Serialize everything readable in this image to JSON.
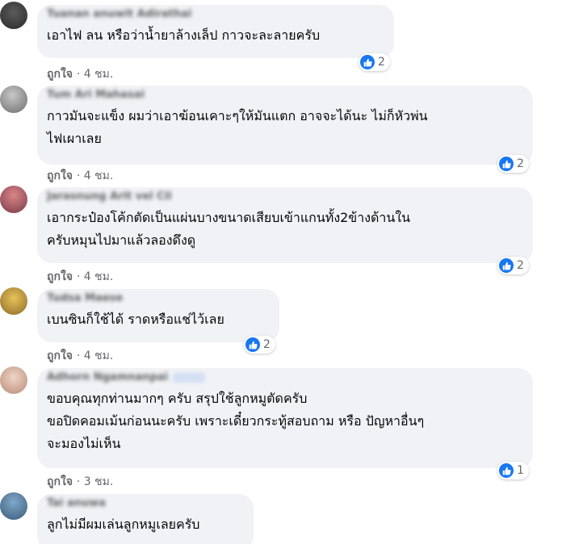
{
  "like_label": "ถูกใจ",
  "separator": "·",
  "colors": {
    "like_blue": "#1877f2",
    "bubble_bg": "#f0f2f5",
    "meta_grey": "#65676b"
  },
  "icons": {
    "reaction": "thumbs-up-icon"
  },
  "comments": [
    {
      "author": "Tuanan anuwit Adirathai",
      "text": "เอาไฟ ลน หรือว่าน้ำยาล้างเล็ป กาวจะละลายครับ",
      "time": "4 ชม.",
      "reactions": "2"
    },
    {
      "author": "Tum Ari Mahasai",
      "text": "กาวมันจะแข็ง ผมว่าเอาฆ้อนเคาะๆให้มันแตก อาจจะได้นะ ไม่ก็หัวพ่น\nไฟเผาเลย",
      "time": "4 ชม.",
      "reactions": "2"
    },
    {
      "author": "Jarasnung Arit vel Cil",
      "text": "เอากระป๋องโค้กตัดเป็นแผ่นบางขนาดเสียบเข้าแกนทั้ง2ข้างด้านใน\nครับหมุนไปมาแล้วลองดึงดู",
      "time": "4 ชม.",
      "reactions": "2"
    },
    {
      "author": "Tudsa Maese",
      "text": "เบนซินก็ใช้ได้ ราดหรือแช่ไว้เลย",
      "time": "4 ชม.",
      "reactions": "2"
    },
    {
      "author": "Adhorn Ngamnanpai",
      "text": "ขอบคุณทุกท่านมากๆ ครับ สรุปใช้ลูกหมูตัดครับ\nขอปิดคอมเม้นก่อนนะครับ เพราะเดี๋ยวกระทู้สอบถาม หรือ ปัญหาอื่นๆ\nจะมองไม่เห็น",
      "time": "3 ชม.",
      "reactions": "1"
    },
    {
      "author": "Tai anuwa",
      "text": "ลูกไม่มีผมเล่นลูกหมูเลยครับ",
      "time": "",
      "reactions": ""
    }
  ]
}
